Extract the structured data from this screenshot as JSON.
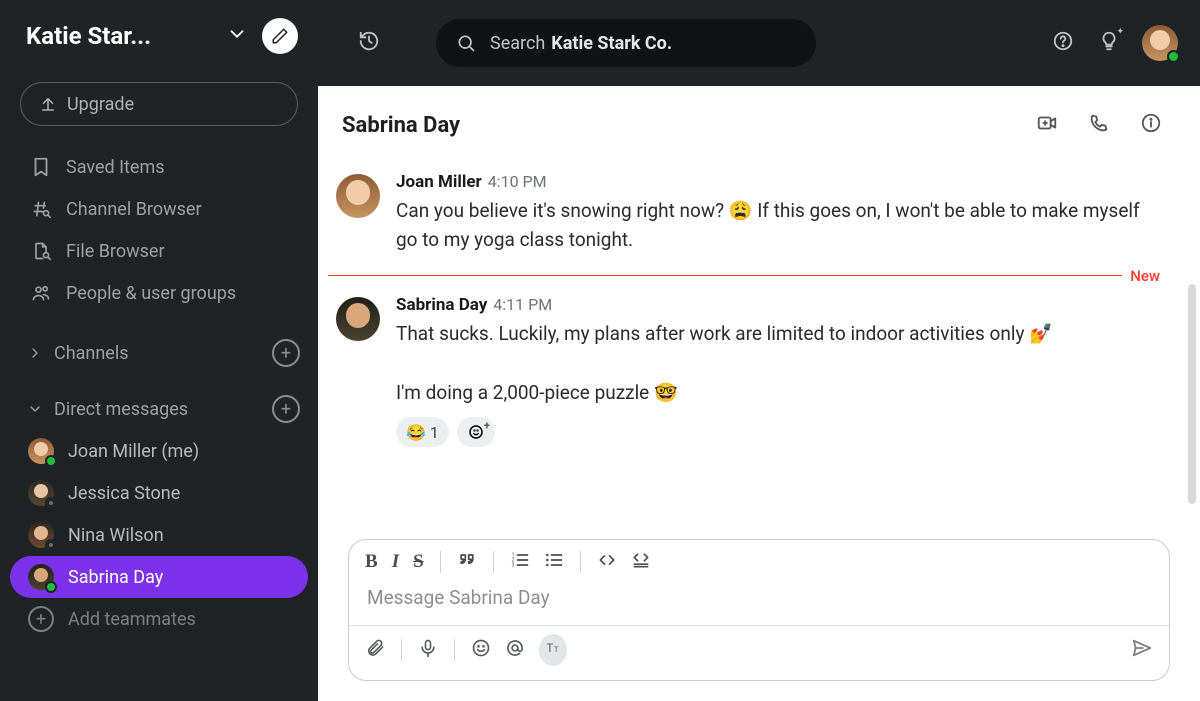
{
  "workspace": {
    "name_truncated": "Katie Star...",
    "name_full": "Katie Stark Co."
  },
  "upgrade_label": "Upgrade",
  "nav": {
    "saved": "Saved Items",
    "channel_browser": "Channel Browser",
    "file_browser": "File Browser",
    "people": "People & user groups"
  },
  "sections": {
    "channels": "Channels",
    "direct_messages": "Direct messages"
  },
  "dms": [
    {
      "name": "Joan Miller (me)",
      "presence": "on",
      "avatar_class": "avatar-joan"
    },
    {
      "name": "Jessica Stone",
      "presence": "off",
      "avatar_class": "avatar-jessica"
    },
    {
      "name": "Nina Wilson",
      "presence": "off",
      "avatar_class": "avatar-nina"
    },
    {
      "name": "Sabrina Day",
      "presence": "on",
      "avatar_class": "avatar-sabrina",
      "active": true
    }
  ],
  "add_teammates": "Add teammates",
  "search_prompt": "Search",
  "conversation": {
    "title": "Sabrina Day"
  },
  "new_label": "New",
  "messages": [
    {
      "author": "Joan Miller",
      "time": "4:10 PM",
      "avatar_class": "avatar-joan",
      "html": "Can you believe it's snowing right now? 😩 If this goes on, I won't be able to make myself go to my yoga class tonight."
    },
    {
      "author": "Sabrina Day",
      "time": "4:11 PM",
      "avatar_class": "avatar-sabrina",
      "html": "That sucks. Luckily, my plans after work are limited to indoor activities only 💅<br><br>I'm doing a 2,000-piece puzzle 🤓",
      "reactions": [
        {
          "emoji": "😂",
          "count": 1
        }
      ]
    }
  ],
  "composer": {
    "placeholder": "Message Sabrina Day"
  }
}
